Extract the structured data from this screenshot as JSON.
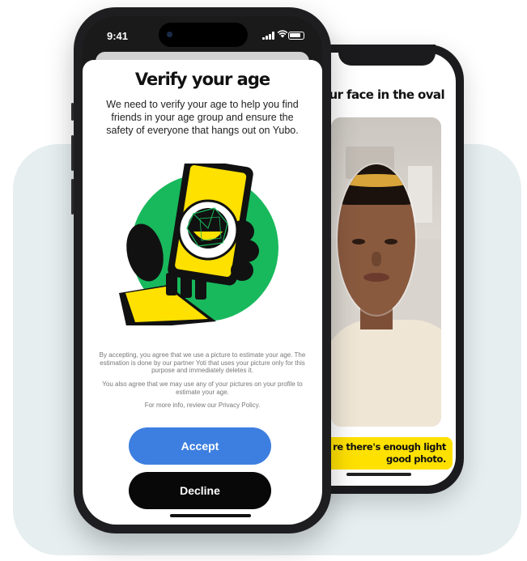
{
  "status_bar": {
    "time": "9:41"
  },
  "verify_screen": {
    "title": "Verify your age",
    "description": "We need to verify your age to help you find friends in your age group and ensure the safety of everyone that hangs out on Yubo.",
    "legal_paragraph_1": "By accepting, you agree that we use a picture to estimate your age. The estimation is done by our partner Yoti that uses your picture only for this purpose and immediately deletes it.",
    "legal_paragraph_2": "You also agree that we may use any of your pictures on your profile to estimate your age.",
    "legal_paragraph_3": "For more info, review our Privacy Policy.",
    "accept_label": "Accept",
    "decline_label": "Decline"
  },
  "camera_screen": {
    "title_fragment": "ur face in the oval",
    "tip_line_1": "re there's enough light",
    "tip_line_2": "good photo."
  },
  "colors": {
    "accept": "#3d7fe0",
    "decline": "#080808",
    "illustration_green": "#18b95c",
    "illustration_yellow": "#ffe100",
    "background_card": "#e6eeef"
  },
  "icons": [
    "signal-icon",
    "wifi-icon",
    "battery-icon",
    "phone-face-scan-illustration"
  ]
}
